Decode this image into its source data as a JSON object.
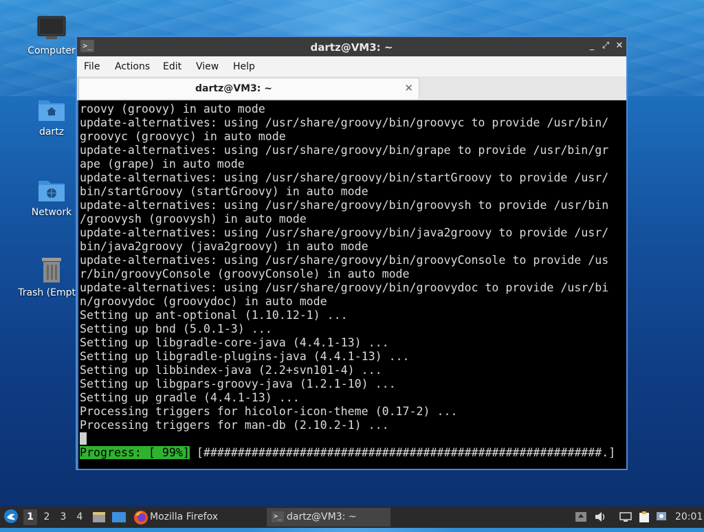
{
  "desktop": {
    "icons": [
      {
        "label": "Computer",
        "icon": "computer-icon"
      },
      {
        "label": "dartz",
        "icon": "home-folder-icon"
      },
      {
        "label": "Network",
        "icon": "network-folder-icon"
      },
      {
        "label": "Trash (Empty)",
        "icon": "trash-icon"
      }
    ]
  },
  "window": {
    "title": "dartz@VM3: ~",
    "controls": {
      "minimize": "_",
      "maximize": "⤢",
      "close": "✕"
    },
    "menu": [
      "File",
      "Actions",
      "Edit",
      "View",
      "Help"
    ],
    "tab": {
      "label": "dartz@VM3: ~",
      "close": "✕"
    }
  },
  "terminal": {
    "lines": [
      "roovy (groovy) in auto mode",
      "update-alternatives: using /usr/share/groovy/bin/groovyc to provide /usr/bin/",
      "groovyc (groovyc) in auto mode",
      "update-alternatives: using /usr/share/groovy/bin/grape to provide /usr/bin/gr",
      "ape (grape) in auto mode",
      "update-alternatives: using /usr/share/groovy/bin/startGroovy to provide /usr/",
      "bin/startGroovy (startGroovy) in auto mode",
      "update-alternatives: using /usr/share/groovy/bin/groovysh to provide /usr/bin",
      "/groovysh (groovysh) in auto mode",
      "update-alternatives: using /usr/share/groovy/bin/java2groovy to provide /usr/",
      "bin/java2groovy (java2groovy) in auto mode",
      "update-alternatives: using /usr/share/groovy/bin/groovyConsole to provide /us",
      "r/bin/groovyConsole (groovyConsole) in auto mode",
      "update-alternatives: using /usr/share/groovy/bin/groovydoc to provide /usr/bi",
      "n/groovydoc (groovydoc) in auto mode",
      "Setting up ant-optional (1.10.12-1) ...",
      "Setting up bnd (5.0.1-3) ...",
      "Setting up libgradle-core-java (4.4.1-13) ...",
      "Setting up libgradle-plugins-java (4.4.1-13) ...",
      "Setting up libbindex-java (2.2+svn101-4) ...",
      "Setting up libgpars-groovy-java (1.2.1-10) ...",
      "Setting up gradle (4.4.1-13) ...",
      "Processing triggers for hicolor-icon-theme (0.17-2) ...",
      "Processing triggers for man-db (2.10.2-1) ..."
    ],
    "progress_label": "Progress: [ 99%]",
    "progress_bar": " [##########################################################.]",
    "progress_percent": 99
  },
  "taskbar": {
    "workspaces": [
      "1",
      "2",
      "3",
      "4"
    ],
    "active_workspace": "1",
    "tasks": [
      {
        "label": "Mozilla Firefox",
        "icon": "firefox-icon"
      },
      {
        "label": "dartz@VM3: ~",
        "icon": "terminal-icon"
      }
    ],
    "clock": "20:01"
  }
}
